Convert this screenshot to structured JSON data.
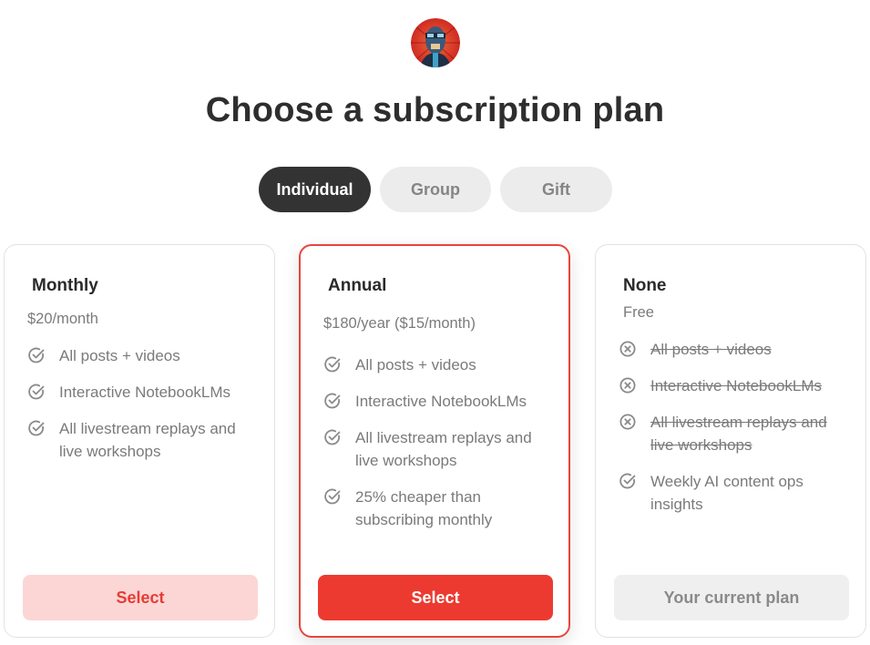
{
  "page": {
    "title": "Choose a subscription plan"
  },
  "tabs": [
    {
      "label": "Individual",
      "active": true
    },
    {
      "label": "Group",
      "active": false
    },
    {
      "label": "Gift",
      "active": false
    }
  ],
  "plans": [
    {
      "name": "Monthly",
      "price": "$20/month",
      "features": [
        {
          "text": "All posts + videos",
          "included": true,
          "icon": "check-circle-icon"
        },
        {
          "text": "Interactive NotebookLMs",
          "included": true,
          "icon": "check-circle-icon"
        },
        {
          "text": "All livestream replays and live workshops",
          "included": true,
          "icon": "check-circle-icon"
        }
      ],
      "button_label": "Select"
    },
    {
      "name": "Annual",
      "price": "$180/year ($15/month)",
      "features": [
        {
          "text": "All posts + videos",
          "included": true,
          "icon": "check-circle-icon"
        },
        {
          "text": "Interactive NotebookLMs",
          "included": true,
          "icon": "check-circle-icon"
        },
        {
          "text": "All livestream replays and live workshops",
          "included": true,
          "icon": "check-circle-icon"
        },
        {
          "text": "25% cheaper than subscribing monthly",
          "included": true,
          "icon": "check-circle-icon"
        }
      ],
      "button_label": "Select"
    },
    {
      "name": "None",
      "price": "Free",
      "features": [
        {
          "text": "All posts + videos",
          "included": false,
          "icon": "x-circle-icon"
        },
        {
          "text": "Interactive NotebookLMs",
          "included": false,
          "icon": "x-circle-icon"
        },
        {
          "text": "All livestream replays and live workshops",
          "included": false,
          "icon": "x-circle-icon"
        },
        {
          "text": "Weekly AI content ops insights",
          "included": true,
          "icon": "check-circle-icon"
        }
      ],
      "button_label": "Your current plan"
    }
  ],
  "colors": {
    "accent": "#ec3a30",
    "accent_light": "#fbd6d5",
    "active_tab": "#333333",
    "inactive_tab": "#ececec"
  }
}
